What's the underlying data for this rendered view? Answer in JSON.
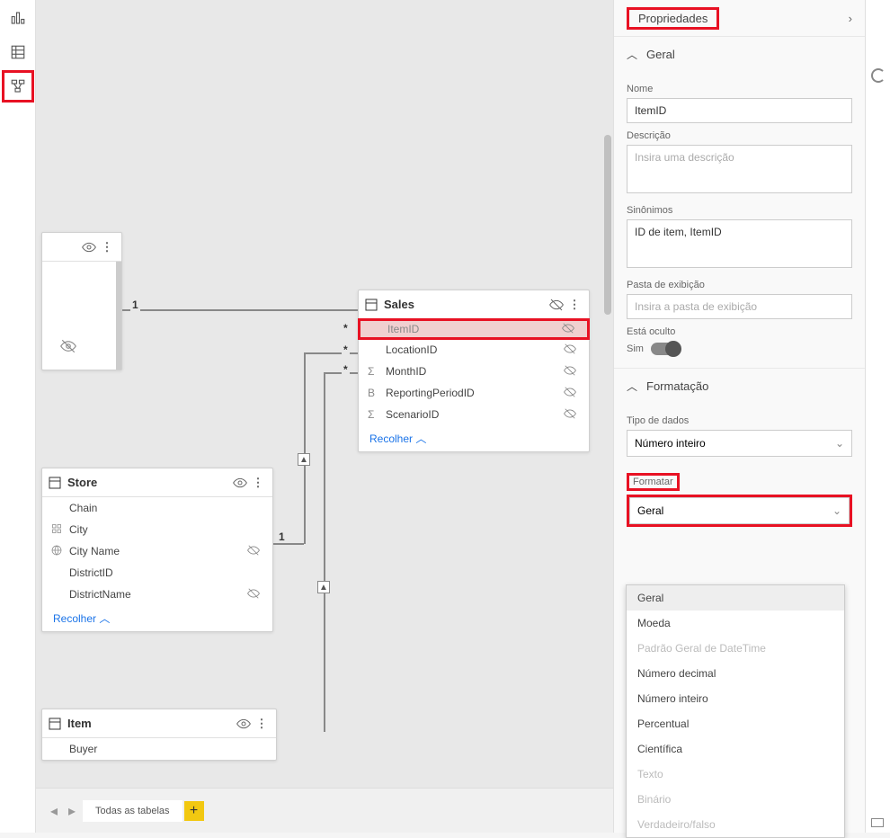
{
  "leftbar": {
    "active_index": 2
  },
  "tables": {
    "store": {
      "title": "Store",
      "fields": [
        {
          "name": "Chain",
          "hidden": false
        },
        {
          "name": "City",
          "hidden": false,
          "icon": "grid"
        },
        {
          "name": "City Name",
          "hidden": true,
          "icon": "globe"
        },
        {
          "name": "DistrictID",
          "hidden": false
        },
        {
          "name": "DistrictName",
          "hidden": true
        }
      ],
      "collapse": "Recolher"
    },
    "sales": {
      "title": "Sales",
      "fields": [
        {
          "name": "ItemID",
          "hidden": true,
          "selected": true
        },
        {
          "name": "LocationID",
          "hidden": true
        },
        {
          "name": "MonthID",
          "hidden": true,
          "icon": "sigma"
        },
        {
          "name": "ReportingPeriodID",
          "hidden": true,
          "icon": "B"
        },
        {
          "name": "ScenarioID",
          "hidden": true,
          "icon": "sigma"
        }
      ],
      "collapse": "Recolher"
    },
    "item": {
      "title": "Item",
      "fields": [
        {
          "name": "Buyer",
          "hidden": false
        }
      ]
    },
    "small": {}
  },
  "properties": {
    "title": "Propriedades",
    "general": {
      "header": "Geral",
      "name_label": "Nome",
      "name_value": "ItemID",
      "desc_label": "Descrição",
      "desc_placeholder": "Insira uma descrição",
      "syn_label": "Sinônimos",
      "syn_value": "ID de item, ItemID",
      "folder_label": "Pasta de exibição",
      "folder_placeholder": "Insira a pasta de exibição",
      "hidden_label": "Está oculto",
      "hidden_value": "Sim"
    },
    "formatting": {
      "header": "Formatação",
      "type_label": "Tipo de dados",
      "type_value": "Número inteiro",
      "format_label": "Formatar",
      "format_value": "Geral",
      "options": [
        {
          "label": "Geral",
          "sel": true
        },
        {
          "label": "Moeda"
        },
        {
          "label": "Padrão Geral de DateTime",
          "disabled": true
        },
        {
          "label": "Número decimal"
        },
        {
          "label": "Número inteiro"
        },
        {
          "label": "Percentual"
        },
        {
          "label": "Científica"
        },
        {
          "label": "Texto",
          "disabled": true
        },
        {
          "label": "Binário",
          "disabled": true
        },
        {
          "label": "Verdadeiro/falso",
          "disabled": true
        }
      ]
    }
  },
  "footer": {
    "tab": "Todas as tabelas"
  }
}
